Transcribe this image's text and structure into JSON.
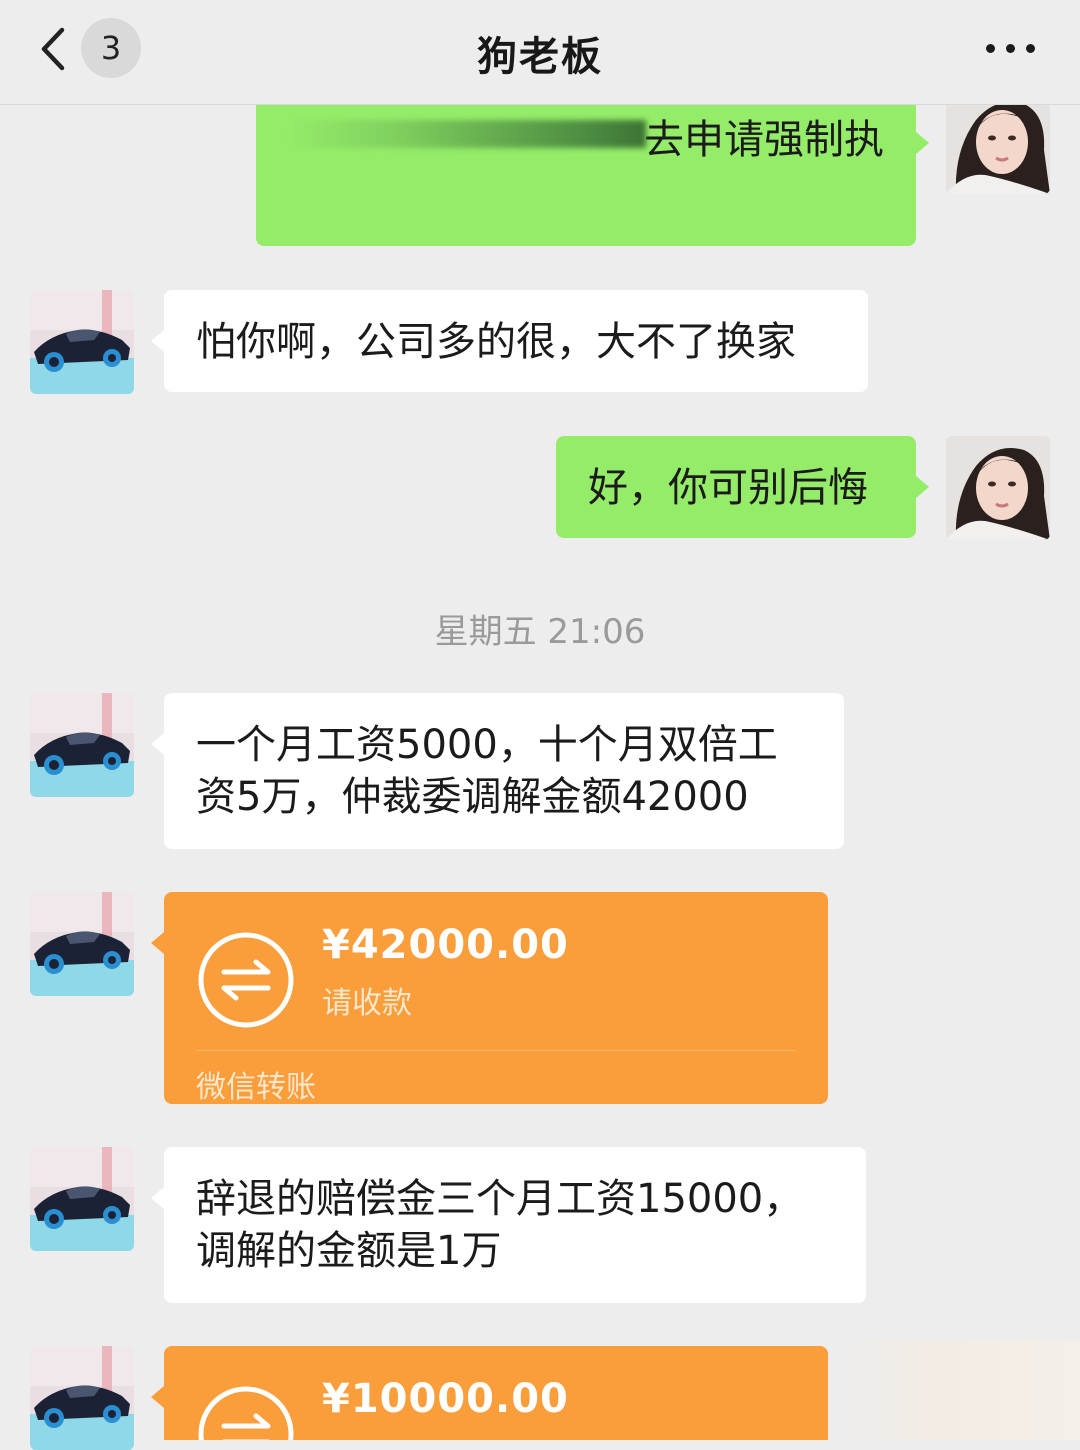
{
  "header": {
    "back_icon": "chevron-left-icon",
    "unread_count": "3",
    "title": "狗老板",
    "more_icon": "more-dots-icon"
  },
  "colors": {
    "background": "#ededed",
    "sent_bubble": "#95ec69",
    "received_bubble": "#ffffff",
    "transfer_card": "#fa9d3b",
    "timestamp_text": "#9a9a9a"
  },
  "messages": [
    {
      "side": "right",
      "type": "text",
      "text": "去申请强制执",
      "partially_obscured": true
    },
    {
      "side": "left",
      "type": "text",
      "text": "怕你啊，公司多的很，大不了换家"
    },
    {
      "side": "right",
      "type": "text",
      "text": "好，你可别后悔"
    },
    {
      "type": "timestamp",
      "text": "星期五 21:06"
    },
    {
      "side": "left",
      "type": "text",
      "lines": [
        "一个月工资5000，十个月双倍工",
        "资5万，仲裁委调解金额42000"
      ]
    },
    {
      "side": "left",
      "type": "transfer",
      "amount": "¥42000.00",
      "status": "请收款",
      "footer": "微信转账",
      "icon": "transfer-arrows-icon"
    },
    {
      "side": "left",
      "type": "text",
      "lines": [
        "辞退的赔偿金三个月工资15000，",
        "调解的金额是1万"
      ]
    },
    {
      "side": "left",
      "type": "transfer",
      "amount": "¥10000.00",
      "icon": "transfer-arrows-icon"
    }
  ]
}
